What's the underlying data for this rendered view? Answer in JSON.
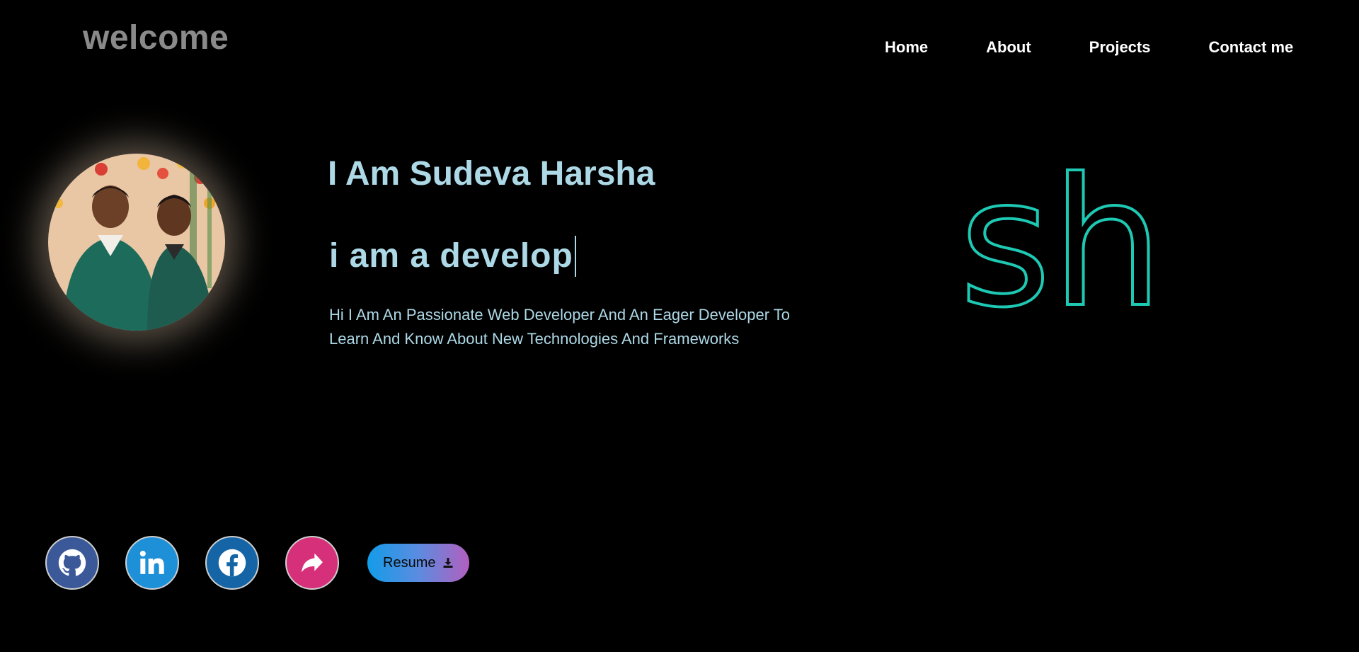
{
  "header": {
    "brand": "welcome",
    "nav": [
      "Home",
      "About",
      "Projects",
      "Contact me"
    ]
  },
  "hero": {
    "name_line": "I Am Sudeva Harsha",
    "typing_text": "i am a develop",
    "description": "Hi I Am An Passionate Web Developer And An Eager Developer To Learn And Know About New Technologies And Frameworks",
    "logo_text": "sh",
    "logo_color": "#1ec9b4"
  },
  "socials": {
    "items": [
      {
        "name": "github",
        "icon": "github-icon",
        "color": "#3b5998"
      },
      {
        "name": "linkedin",
        "icon": "linkedin-icon",
        "color": "#1e90d8"
      },
      {
        "name": "facebook",
        "icon": "facebook-icon",
        "color": "#1565a6"
      },
      {
        "name": "share",
        "icon": "share-icon",
        "color": "#d6307a"
      }
    ],
    "resume_label": "Resume"
  }
}
